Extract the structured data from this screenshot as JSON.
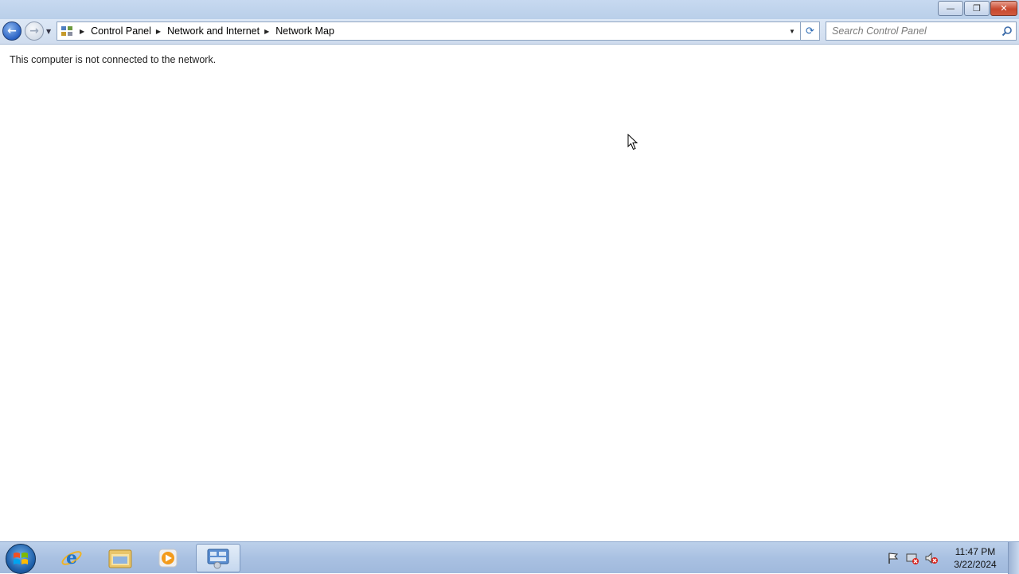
{
  "window": {
    "caption": {
      "minimize_glyph": "—",
      "maximize_glyph": "❐",
      "close_glyph": "✕"
    }
  },
  "navigation": {
    "back_glyph": "←",
    "forward_glyph": "→",
    "history_glyph": "▼",
    "breadcrumbs": [
      "Control Panel",
      "Network and Internet",
      "Network Map"
    ],
    "crumb_separator": "▶",
    "dropdown_glyph": "▼",
    "refresh_glyph": "⟳"
  },
  "search": {
    "placeholder": "Search Control Panel",
    "value": ""
  },
  "content": {
    "status_message": "This computer is not connected to the network."
  },
  "taskbar": {
    "pinned": [
      {
        "name": "internet-explorer-icon"
      },
      {
        "name": "windows-explorer-icon"
      },
      {
        "name": "media-player-icon"
      },
      {
        "name": "control-panel-icon",
        "active": true
      }
    ],
    "tray": {
      "icons": [
        "action-center-flag-icon",
        "network-disconnected-icon",
        "volume-muted-icon"
      ],
      "time": "11:47 PM",
      "date": "3/22/2024"
    }
  },
  "colors": {
    "titlebar": "#c7d9f0",
    "taskbar": "#a9c1e2",
    "accent_blue": "#2a62c4",
    "close_red": "#c8482e"
  }
}
